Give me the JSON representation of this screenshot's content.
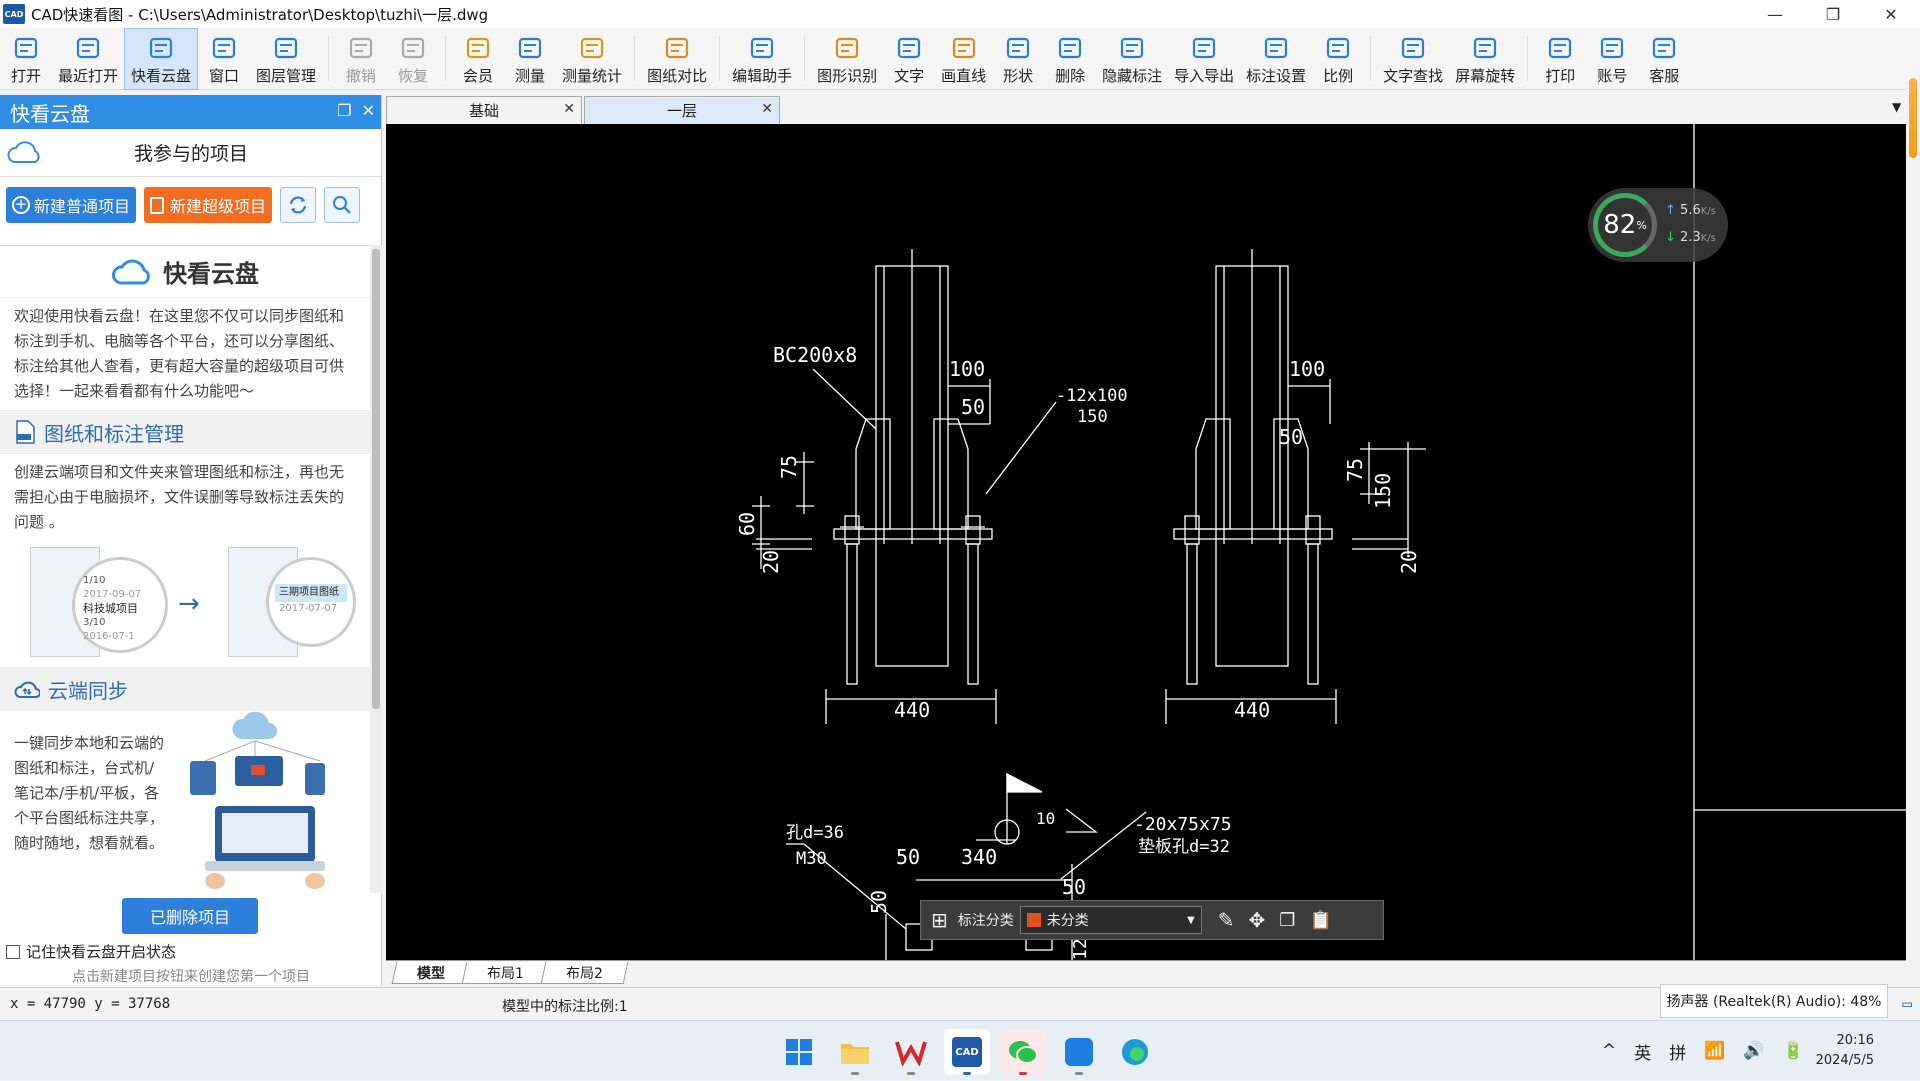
{
  "window": {
    "title": "CAD快速看图 - C:\\Users\\Administrator\\Desktop\\tuzhi\\一层.dwg",
    "logo_text": "CAD",
    "min": "—",
    "max": "❐",
    "close": "✕"
  },
  "toolbar": [
    {
      "label": "打开",
      "icon": "folder-open-icon",
      "color": "#2a7fd4"
    },
    {
      "label": "最近打开",
      "icon": "recent-icon",
      "color": "#2a7fd4"
    },
    {
      "label": "快看云盘",
      "icon": "cloud-icon",
      "color": "#2a7fd4",
      "active": true
    },
    {
      "label": "窗口",
      "icon": "window-icon",
      "color": "#2a7fd4"
    },
    {
      "label": "图层管理",
      "icon": "layers-icon",
      "color": "#2a7fd4"
    },
    {
      "label": "撤销",
      "icon": "undo-icon",
      "color": "#aaaaaa",
      "disabled": true
    },
    {
      "label": "恢复",
      "icon": "redo-icon",
      "color": "#aaaaaa",
      "disabled": true
    },
    {
      "label": "会员",
      "icon": "vip-icon",
      "color": "#d89b18"
    },
    {
      "label": "测量",
      "icon": "measure-icon",
      "color": "#2a7fd4"
    },
    {
      "label": "测量统计",
      "icon": "measure-stats-icon",
      "color": "#d89b18"
    },
    {
      "label": "图纸对比",
      "icon": "compare-icon",
      "color": "#e08a1e"
    },
    {
      "label": "编辑助手",
      "icon": "edit-assistant-icon",
      "color": "#2a7fd4"
    },
    {
      "label": "图形识别",
      "icon": "shape-recognize-icon",
      "color": "#e08a1e"
    },
    {
      "label": "文字",
      "icon": "text-icon",
      "color": "#2a7fd4"
    },
    {
      "label": "画直线",
      "icon": "line-icon",
      "color": "#e08a1e"
    },
    {
      "label": "形状",
      "icon": "shapes-icon",
      "color": "#2a7fd4"
    },
    {
      "label": "删除",
      "icon": "eraser-icon",
      "color": "#2a7fd4"
    },
    {
      "label": "隐藏标注",
      "icon": "hide-annotation-icon",
      "color": "#2a7fd4"
    },
    {
      "label": "导入导出",
      "icon": "import-export-icon",
      "color": "#2a7fd4"
    },
    {
      "label": "标注设置",
      "icon": "annotation-settings-icon",
      "color": "#2a7fd4"
    },
    {
      "label": "比例",
      "icon": "ratio-icon",
      "color": "#2a7fd4"
    },
    {
      "label": "文字查找",
      "icon": "text-search-icon",
      "color": "#2a7fd4"
    },
    {
      "label": "屏幕旋转",
      "icon": "rotate-screen-icon",
      "color": "#2a7fd4"
    },
    {
      "label": "打印",
      "icon": "print-icon",
      "color": "#2a7fd4"
    },
    {
      "label": "账号",
      "icon": "account-icon",
      "color": "#2a7fd4"
    },
    {
      "label": "客服",
      "icon": "support-icon",
      "color": "#2a7fd4"
    }
  ],
  "panel": {
    "title": "快看云盘",
    "project_heading": "我参与的项目",
    "new_normal": "新建普通项目",
    "new_super": "新建超级项目",
    "brand": "快看云盘",
    "intro": "欢迎使用快看云盘！在这里您不仅可以同步图纸和标注到手机、电脑等各个平台，还可以分享图纸、标注给其他人查看，更有超大容量的超级项目可供选择！一起来看看都有什么功能吧～",
    "section1_title": "图纸和标注管理",
    "section1_text": "创建云端项目和文件夹来管理图纸和标注，再也无需担心由于电脑损坏，文件误删等导致标注丢失的问题 。",
    "illus_items": [
      "科技城项目",
      "三期项目图纸"
    ],
    "illus_dates": [
      "2017-09-07",
      "2016-07-1",
      "2017-07-07"
    ],
    "illus_counts": [
      "1/10",
      "3/10"
    ],
    "section2_title": "云端同步",
    "section2_text": "一键同步本地和云端的图纸和标注，台式机/笔记本/手机/平板，各个平台图纸标注共享，随时随地，想看就看。",
    "deleted": "已删除项目",
    "remember": "记住快看云盘开启状态",
    "hint": "点击新建项目按钮来创建您第一个项目"
  },
  "tabs": [
    {
      "label": "基础",
      "active": false
    },
    {
      "label": "一层",
      "active": true
    }
  ],
  "layout_tabs": [
    "模型",
    "布局1",
    "布局2"
  ],
  "drawing": {
    "labels": {
      "bc": "BC200x8",
      "d100a": "100",
      "d50a": "50",
      "plate": "-12x100",
      "plate2": "150",
      "d75a": "75",
      "d60": "60",
      "d20a": "20",
      "d440a": "440",
      "d100b": "100",
      "d50b": "50",
      "d75b": "75",
      "d150b": "150",
      "d20b": "20",
      "d440b": "440",
      "hole1": "孔d=36",
      "m30": "M30",
      "d50c": "50",
      "d340": "340",
      "d50d": "50",
      "d50e": "50",
      "d10": "10",
      "angle": "-20x75x75",
      "washer": "垫板孔d=32",
      "d12": "12"
    }
  },
  "mini_toolbar": {
    "category_label": "标注分类",
    "selected": "未分类",
    "selected_color": "#e0531a"
  },
  "net_monitor": {
    "percent": "82",
    "unit": "%",
    "up": "5.6",
    "down": "2.3",
    "rate_unit": "K/s"
  },
  "status": {
    "coords": "x = 47790  y = 37768",
    "scale": "模型中的标注比例:1"
  },
  "volume_popup": "扬声器 (Realtek(R) Audio): 48%",
  "taskbar": {
    "apps": [
      "windows-start-icon",
      "file-explorer-icon",
      "wps-icon",
      "cad-viewer-icon",
      "wechat-icon",
      "dingtalk-icon",
      "edge-icon"
    ],
    "tray": [
      "^",
      "英",
      "拼"
    ],
    "time": "20:16",
    "date": "2024/5/5"
  }
}
